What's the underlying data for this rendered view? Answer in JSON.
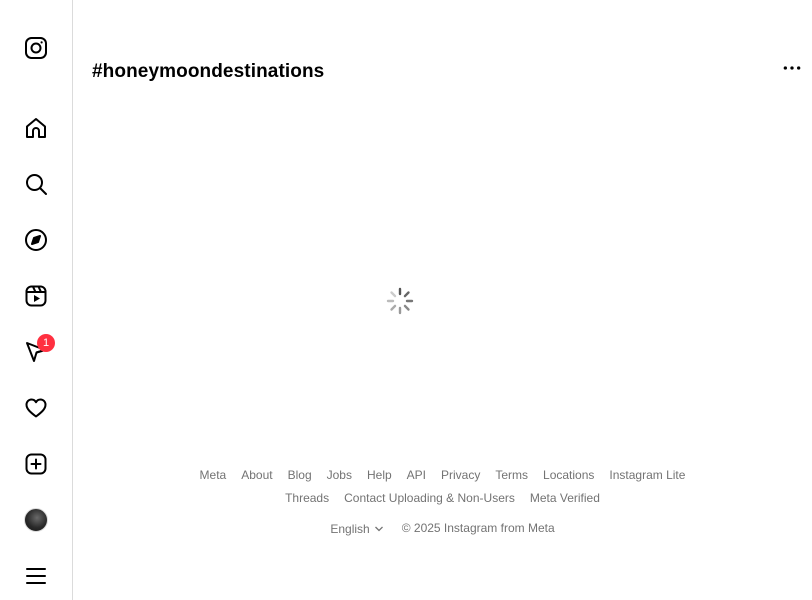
{
  "sidebar": {
    "logo_icon": "instagram-logo-icon",
    "items": [
      {
        "name": "home",
        "icon": "home-icon"
      },
      {
        "name": "search",
        "icon": "search-icon"
      },
      {
        "name": "explore",
        "icon": "compass-icon"
      },
      {
        "name": "reels",
        "icon": "reels-icon"
      },
      {
        "name": "messages",
        "icon": "send-icon",
        "badge": "1"
      },
      {
        "name": "notifications",
        "icon": "heart-icon"
      },
      {
        "name": "create",
        "icon": "plus-square-icon"
      },
      {
        "name": "profile",
        "icon": "avatar"
      },
      {
        "name": "more",
        "icon": "menu-icon"
      }
    ]
  },
  "header": {
    "title": "#honeymoondestinations",
    "more_icon": "more-horizontal-icon"
  },
  "main": {
    "status": "loading"
  },
  "footer": {
    "links": [
      "Meta",
      "About",
      "Blog",
      "Jobs",
      "Help",
      "API",
      "Privacy",
      "Terms",
      "Locations",
      "Instagram Lite",
      "Threads",
      "Contact Uploading & Non-Users",
      "Meta Verified"
    ],
    "language": "English",
    "copyright": "© 2025 Instagram from Meta"
  },
  "colors": {
    "badge": "#ff3040",
    "footer_text": "#737373",
    "divider": "#dbdbdb"
  }
}
